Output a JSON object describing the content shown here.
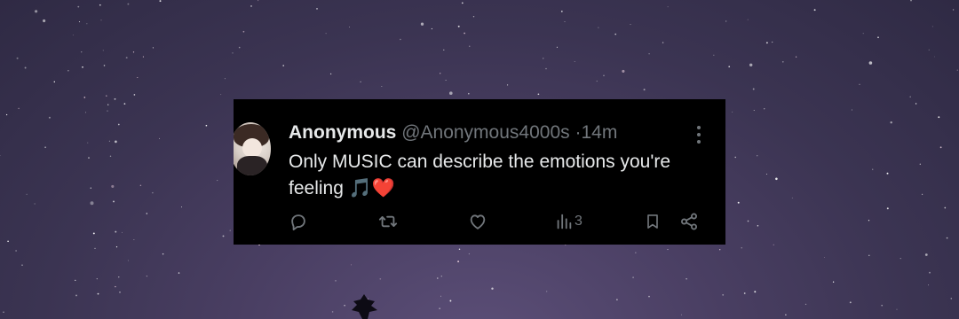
{
  "tweet": {
    "display_name": "Anonymous",
    "handle": "@Anonymous4000s",
    "separator": "·",
    "time": "14m",
    "text_line1": "Only MUSIC can describe the emotions you're",
    "text_line2": "feeling",
    "emoji_note": "🎵",
    "emoji_heart": "❤️"
  },
  "actions": {
    "views_count": "3"
  },
  "icons": {
    "more": "more-vertical-icon",
    "reply": "reply-icon",
    "repost": "repost-icon",
    "like": "heart-icon",
    "views": "views-icon",
    "bookmark": "bookmark-icon",
    "share": "share-icon"
  },
  "colors": {
    "card_background": "#000000",
    "primary_text": "#e7e9ea",
    "secondary_text": "#71767b",
    "sky": "#3b3452"
  }
}
